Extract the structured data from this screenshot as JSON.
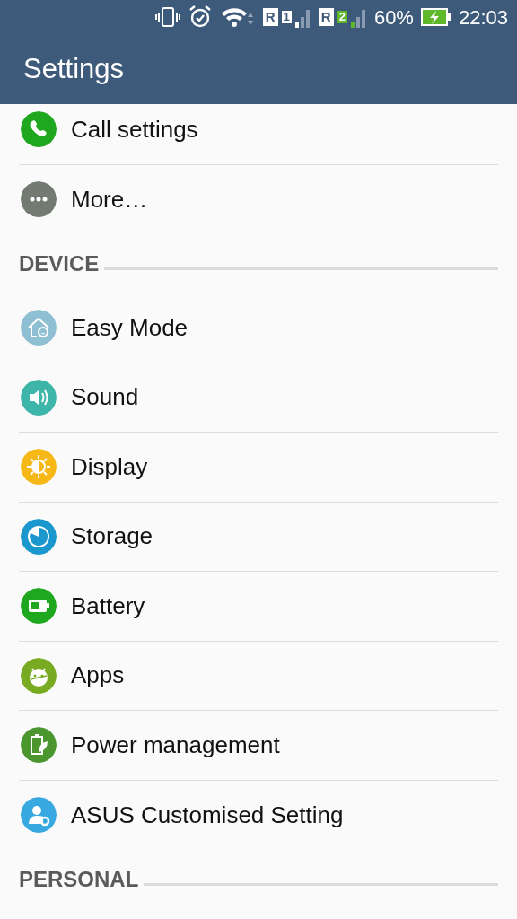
{
  "status_bar": {
    "sim_1": {
      "roaming": "R",
      "slot": "1"
    },
    "sim_2": {
      "roaming": "R",
      "slot": "2"
    },
    "battery": "60%",
    "time": "22:03"
  },
  "app_bar": {
    "title": "Settings"
  },
  "sections": [
    {
      "items": [
        {
          "label": "Call settings",
          "color": "#1fa81f"
        },
        {
          "label": "More…",
          "color": "#727a72"
        }
      ]
    },
    {
      "header": "DEVICE",
      "items": [
        {
          "label": "Easy Mode",
          "color": "#8fbfd3"
        },
        {
          "label": "Sound",
          "color": "#3db5a8"
        },
        {
          "label": "Display",
          "color": "#f6b817"
        },
        {
          "label": "Storage",
          "color": "#1a97cc"
        },
        {
          "label": "Battery",
          "color": "#1fa81f"
        },
        {
          "label": "Apps",
          "color": "#79ab22"
        },
        {
          "label": "Power management",
          "color": "#4b962e"
        },
        {
          "label": "ASUS Customised Setting",
          "color": "#38a8e0"
        }
      ]
    },
    {
      "header": "PERSONAL"
    }
  ]
}
